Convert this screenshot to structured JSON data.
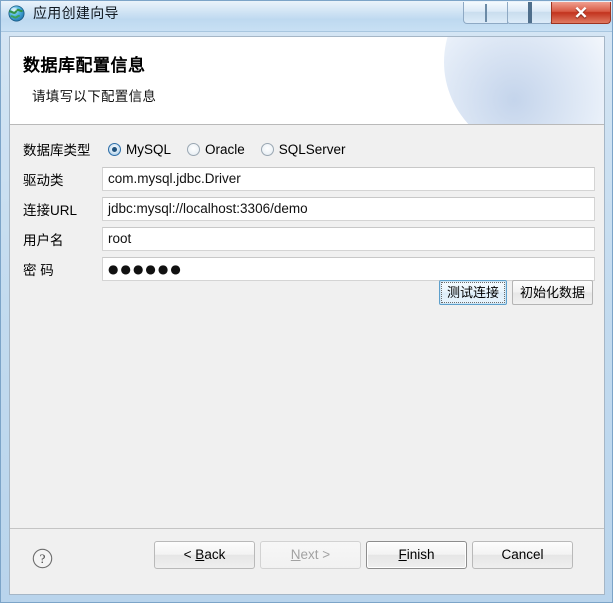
{
  "window": {
    "title": "应用创建向导",
    "icon": "globe-icon",
    "controls": {
      "minimize": "minimize-button",
      "maximize": "maximize-button",
      "close_glyph": "✕"
    }
  },
  "header": {
    "title": "数据库配置信息",
    "subtitle": "请填写以下配置信息"
  },
  "form": {
    "db_type": {
      "label": "数据库类型",
      "options": [
        {
          "label": "MySQL",
          "selected": true
        },
        {
          "label": "Oracle",
          "selected": false
        },
        {
          "label": "SQLServer",
          "selected": false
        }
      ]
    },
    "fields": [
      {
        "label": "驱动类",
        "value": "com.mysql.jdbc.Driver"
      },
      {
        "label": "连接URL",
        "value": "jdbc:mysql://localhost:3306/demo"
      },
      {
        "label": "用户名",
        "value": "root"
      },
      {
        "label": "密 码",
        "value": "●●●●●●"
      }
    ],
    "actions": [
      {
        "label": "测试连接",
        "focused": true
      },
      {
        "label": "初始化数据",
        "focused": false
      }
    ]
  },
  "footer": {
    "help_glyph": "?",
    "buttons": [
      {
        "id": "back",
        "prefix": "< ",
        "mnemonic": "B",
        "suffix": "ack",
        "disabled": false,
        "default": false
      },
      {
        "id": "next",
        "prefix": "",
        "mnemonic": "N",
        "suffix": "ext >",
        "disabled": true,
        "default": false
      },
      {
        "id": "finish",
        "prefix": "",
        "mnemonic": "F",
        "suffix": "inish",
        "disabled": false,
        "default": true
      },
      {
        "id": "cancel",
        "prefix": "",
        "mnemonic": "",
        "suffix": "Cancel",
        "disabled": false,
        "default": false
      }
    ]
  },
  "colors": {
    "titlebar": "#c3dbef",
    "panel": "#f0f0f0",
    "accent": "#2d6ea8",
    "close": "#c2321d"
  }
}
